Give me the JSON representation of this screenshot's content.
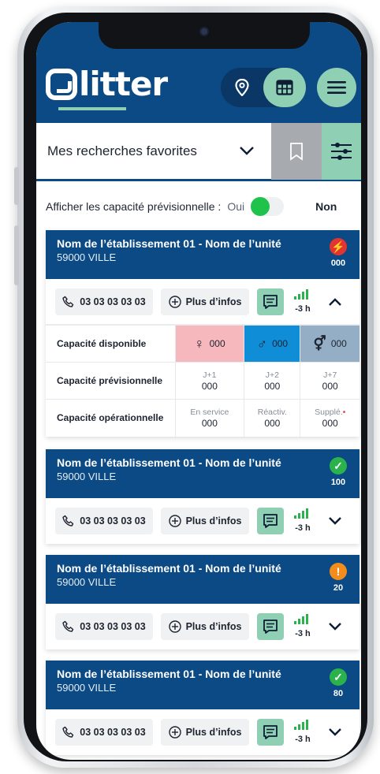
{
  "app": {
    "logo_text": "litter",
    "view_toggle": {
      "map_icon": "location-pin-icon",
      "table_icon": "table-icon",
      "active": "table"
    },
    "menu_icon": "hamburger-menu-icon"
  },
  "search": {
    "label": "Mes recherches favorites",
    "bookmark_icon": "bookmark-icon",
    "filter_icon": "sliders-icon"
  },
  "preview": {
    "label": "Afficher les capacité prévisionnelle :",
    "oui": "Oui",
    "non": "Non",
    "enabled": true
  },
  "colors": {
    "brand_blue": "#0b4a84",
    "mint": "#8fcfb4",
    "female": "#f7b8bd",
    "male": "#0f8dd6",
    "other": "#94aec6",
    "status_red": "#e3342f",
    "status_green": "#2bb24c",
    "status_orange": "#f28c1c"
  },
  "cards": [
    {
      "title": "Nom de l’établissement 01 - Nom de l’unité",
      "city": "59000 VILLE",
      "status_icon": "lightning-icon",
      "status_color": "#e3342f",
      "status_glyph": "⚡",
      "count": "000",
      "phone": "03 03 03 03 03",
      "info": "Plus d’infos",
      "signal_time": "-3 h",
      "expanded": true
    },
    {
      "title": "Nom de l’établissement 01 - Nom de l’unité",
      "city": "59000 VILLE",
      "status_icon": "check-icon",
      "status_color": "#2bb24c",
      "status_glyph": "✓",
      "count": "100",
      "phone": "03 03 03 03 03",
      "info": "Plus d’infos",
      "signal_time": "-3 h",
      "expanded": false
    },
    {
      "title": "Nom de l’établissement 01 - Nom de l’unité",
      "city": "59000 VILLE",
      "status_icon": "exclamation-icon",
      "status_color": "#f28c1c",
      "status_glyph": "!",
      "count": "20",
      "phone": "03 03 03 03 03",
      "info": "Plus d’infos",
      "signal_time": "-3 h",
      "expanded": false
    },
    {
      "title": "Nom de l’établissement 01 - Nom de l’unité",
      "city": "59000 VILLE",
      "status_icon": "check-icon",
      "status_color": "#2bb24c",
      "status_glyph": "✓",
      "count": "80",
      "phone": "03 03 03 03 03",
      "info": "Plus d’infos",
      "signal_time": "-3 h",
      "expanded": false
    }
  ],
  "capacity": {
    "disponible": {
      "label": "Capacité disponible",
      "female": "000",
      "male": "000",
      "other": "000"
    },
    "previsionnelle": {
      "label": "Capacité prévisionnelle",
      "cols": [
        {
          "sub": "J+1",
          "val": "000"
        },
        {
          "sub": "J+2",
          "val": "000"
        },
        {
          "sub": "J+7",
          "val": "000"
        }
      ]
    },
    "operationnelle": {
      "label": "Capacité opérationnelle",
      "cols": [
        {
          "sub": "En service",
          "val": "000"
        },
        {
          "sub": "Réactiv.",
          "val": "000"
        },
        {
          "sub": "Supplé.",
          "val": "000"
        }
      ]
    }
  }
}
